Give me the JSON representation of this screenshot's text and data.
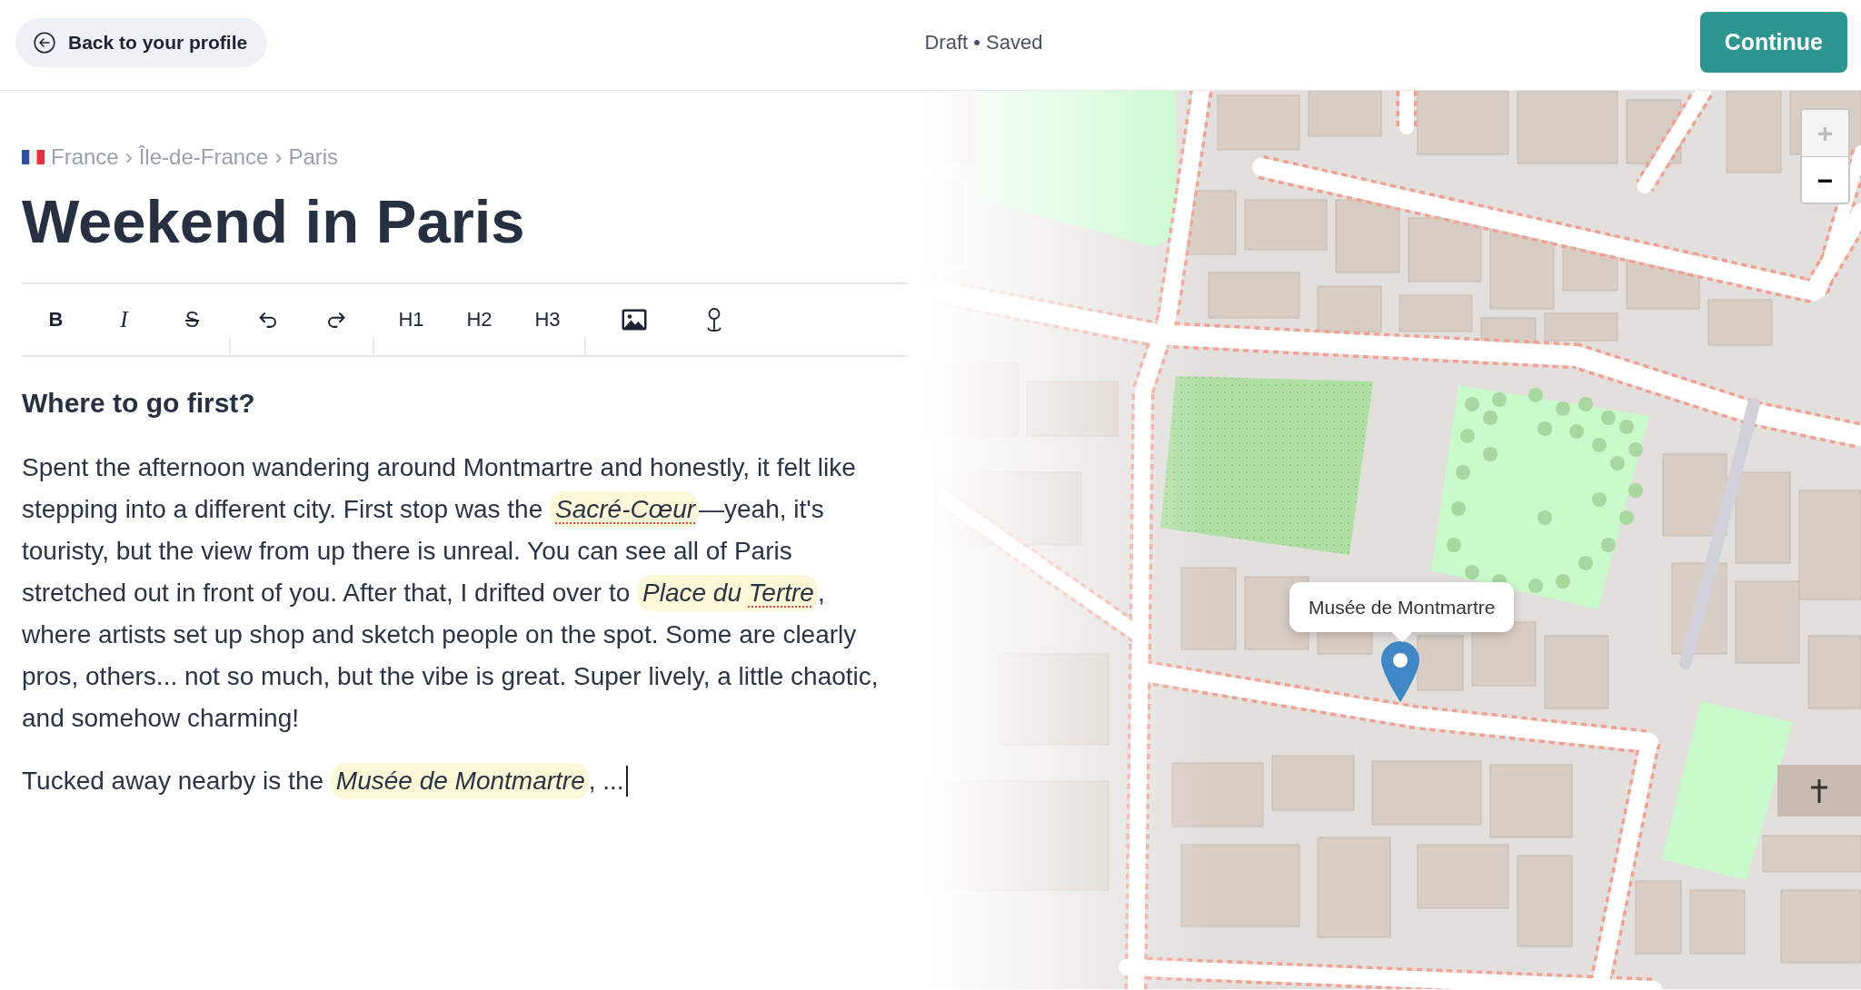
{
  "header": {
    "back_button": "Back to your profile",
    "status": "Draft • Saved",
    "continue_button": "Continue"
  },
  "editor": {
    "breadcrumb": [
      {
        "text": "France",
        "separator": "›"
      },
      {
        "text": "Île-de-France",
        "separator": "›"
      },
      {
        "text": "Paris"
      }
    ],
    "title": "Weekend in Paris",
    "toolbar": [
      [
        {
          "kind": "bold",
          "label": "B"
        },
        {
          "kind": "italic",
          "label": "I"
        },
        {
          "kind": "strikethrough",
          "label": "S"
        }
      ],
      [
        {
          "kind": "undo"
        },
        {
          "kind": "redo"
        }
      ],
      [
        {
          "kind": "heading",
          "label": "H1"
        },
        {
          "kind": "heading",
          "label": "H2"
        },
        {
          "kind": "heading",
          "label": "H3"
        }
      ],
      [
        {
          "kind": "image"
        },
        {
          "kind": "location"
        }
      ]
    ],
    "heading": "Where to go first?",
    "paragraphs": [
      {
        "segments": [
          {
            "kind": "text",
            "text": "Spent the afternoon wandering around Montmartre and honestly, it felt like stepping into a different city. First stop was the "
          },
          {
            "kind": "place",
            "parts": [
              {
                "text": "Sacré-Cœur",
                "misspelled": true
              }
            ]
          },
          {
            "kind": "text",
            "text": "—yeah, it's touristy, but the view from up there is unreal. You can see all of Paris stretched out in front of you. After that, I drifted over to "
          },
          {
            "kind": "place",
            "parts": [
              {
                "text": "Place du ",
                "misspelled": false
              },
              {
                "text": "Tertre",
                "misspelled": true
              }
            ]
          },
          {
            "kind": "text",
            "text": ", where artists set up shop and sketch people on the spot. Some are clearly pros, others... not so much, but the vibe is great. Super lively, a little chaotic, and somehow charming!"
          }
        ],
        "cursor": false
      },
      {
        "segments": [
          {
            "kind": "text",
            "text": "Tucked away nearby is the "
          },
          {
            "kind": "place",
            "parts": [
              {
                "text": "Musée de Montmartre",
                "misspelled": false
              }
            ]
          },
          {
            "kind": "text",
            "text": ", ..."
          }
        ],
        "cursor": true
      }
    ]
  },
  "map": {
    "zoom_in": {
      "label": "+",
      "disabled": true
    },
    "zoom_out": {
      "label": "−",
      "disabled": false
    },
    "popup": "Musée de Montmartre"
  }
}
